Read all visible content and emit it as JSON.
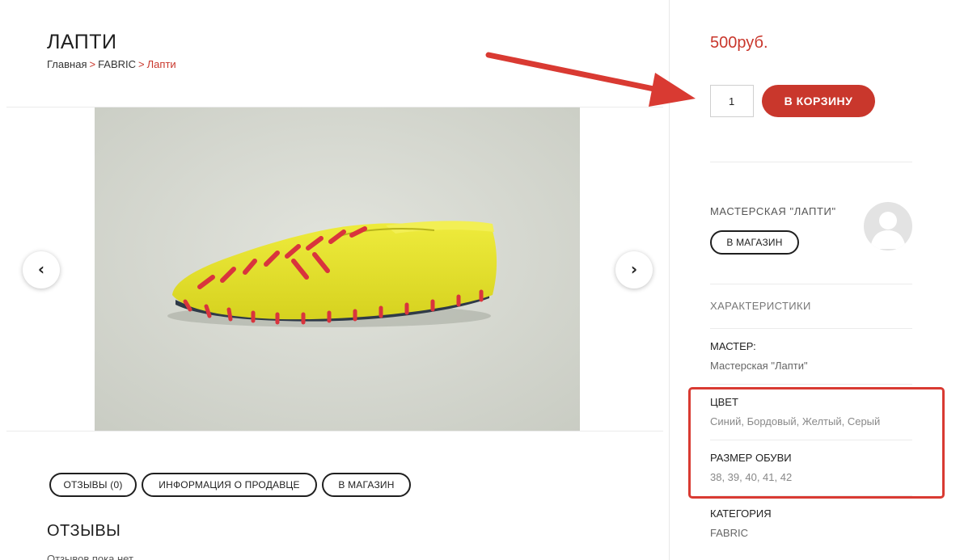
{
  "page": {
    "title": "ЛАПТИ",
    "breadcrumb": [
      {
        "label": "Главная"
      },
      {
        "label": "FABRIC"
      },
      {
        "label": "Лапти"
      }
    ],
    "breadcrumb_separator": ">"
  },
  "gallery": {
    "prev_icon": "chevron-left-icon",
    "next_icon": "chevron-right-icon",
    "prev_glyph": "‹",
    "next_glyph": "›",
    "image_description_icon": "yellow-felt-shoe-image"
  },
  "tabs": [
    {
      "label": "ОТЗЫВЫ (0)"
    },
    {
      "label": "ИНФОРМАЦИЯ О ПРОДАВЦЕ"
    },
    {
      "label": "В МАГАЗИН"
    }
  ],
  "reviews": {
    "heading": "ОТЗЫВЫ",
    "empty_text": "Отзывов пока нет."
  },
  "product": {
    "price": "500руб.",
    "quantity": "1",
    "add_to_cart_label": "В КОРЗИНУ"
  },
  "vendor": {
    "name": "МАСТЕРСКАЯ \"ЛАПТИ\"",
    "shop_button_label": "В МАГАЗИН",
    "avatar_icon": "default-user-avatar-icon"
  },
  "characteristics": {
    "heading": "ХАРАКТЕРИСТИКИ",
    "items": [
      {
        "label": "МАСТЕР:",
        "value": "Мастерская \"Лапти\""
      },
      {
        "label": "ЦВЕТ",
        "value": "Синий, Бордовый, Желтый, Серый"
      },
      {
        "label": "РАЗМЕР ОБУВИ",
        "value": "38, 39, 40, 41, 42"
      },
      {
        "label": "КАТЕГОРИЯ",
        "value": "FABRIC"
      }
    ]
  },
  "colors": {
    "accent": "#c9372c",
    "annotation_red": "#d93a32",
    "text": "#1f1f1f"
  }
}
